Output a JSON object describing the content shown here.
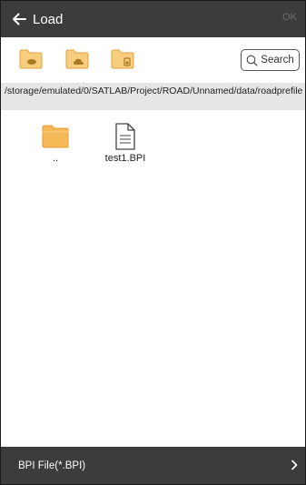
{
  "header": {
    "title": "Load",
    "ok_label": "OK"
  },
  "toolbar": {
    "folder_buttons": [
      "storage-folder-icon",
      "cloud-folder-icon",
      "sdcard-folder-icon"
    ],
    "search_label": "Search"
  },
  "path": "/storage/emulated/0/SATLAB/Project/ROAD/Unnamed/data/roadprefile",
  "files": [
    {
      "name": "..",
      "icon": "folder-icon"
    },
    {
      "name": "test1.BPI",
      "icon": "document-icon"
    }
  ],
  "filter": {
    "label": "BPI File(*.BPI)"
  },
  "colors": {
    "bar": "#3c3c3c",
    "folder": "#f2b84a",
    "pathbar": "#e6e6e6"
  }
}
